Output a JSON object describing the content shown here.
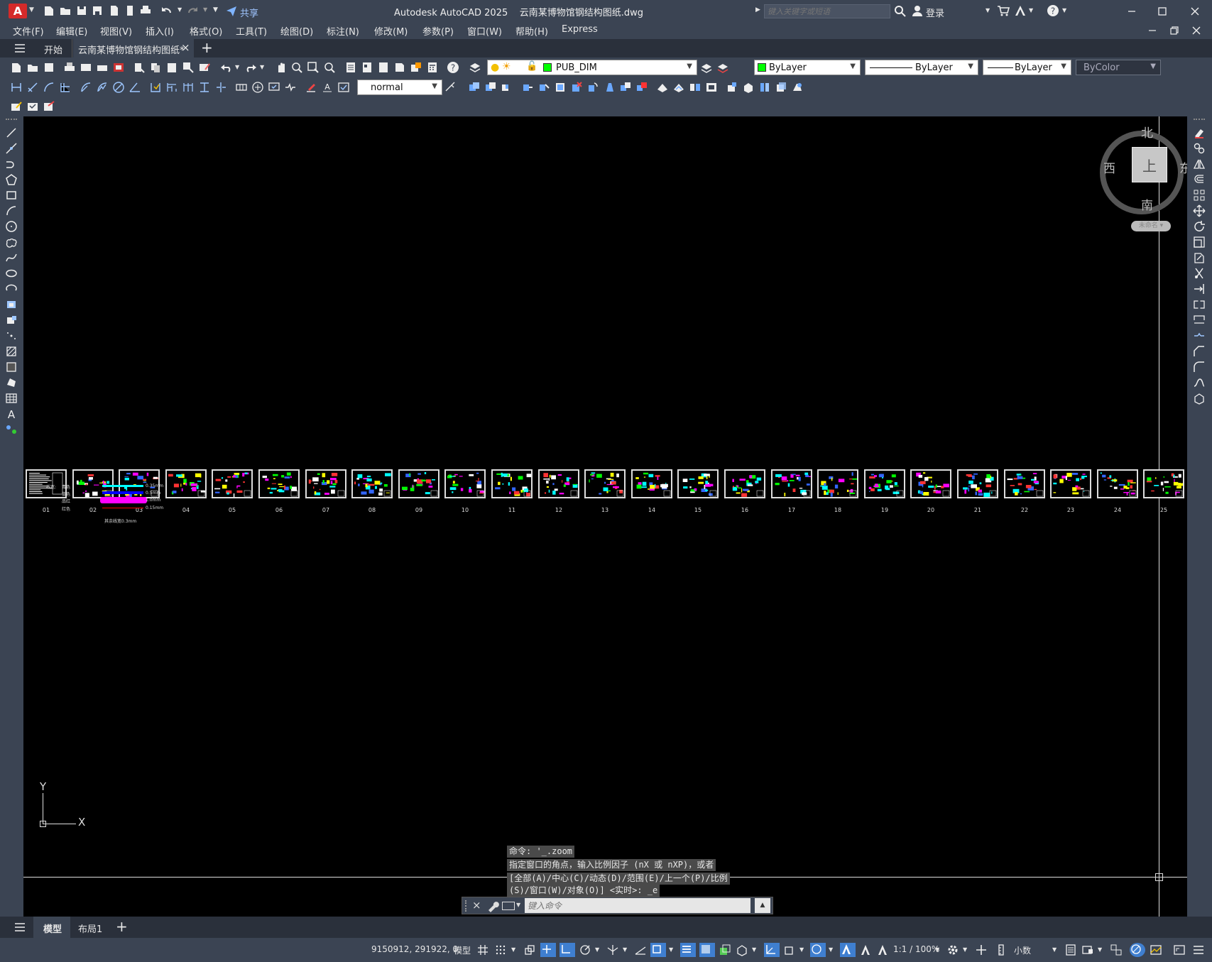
{
  "app": {
    "title": "Autodesk AutoCAD 2025",
    "filename": "云南某博物馆钢结构图纸.dwg",
    "logo_letter": "A",
    "share": "共享",
    "search_placeholder": "键入关键字或短语",
    "login": "登录"
  },
  "menu": [
    "文件(F)",
    "编辑(E)",
    "视图(V)",
    "插入(I)",
    "格式(O)",
    "工具(T)",
    "绘图(D)",
    "标注(N)",
    "修改(M)",
    "参数(P)",
    "窗口(W)",
    "帮助(H)",
    "Express"
  ],
  "tabs": {
    "start": "开始",
    "active": "云南某博物馆钢结构图纸*",
    "close": "×",
    "add": "+"
  },
  "toolbar": {
    "layer": "PUB_DIM",
    "color": "ByLayer",
    "linetype": "ByLayer",
    "lineweight": "ByLayer",
    "plotstyle": "ByColor",
    "textstyle": "normal"
  },
  "viewcube": {
    "north": "北",
    "south": "南",
    "east": "东",
    "west": "西",
    "face": "上",
    "wcs": "未命名"
  },
  "sheets": [
    "01",
    "02",
    "03",
    "04",
    "05",
    "06",
    "07",
    "08",
    "09",
    "10",
    "11",
    "12",
    "13",
    "14",
    "15",
    "16",
    "17",
    "18",
    "19",
    "20",
    "21",
    "22",
    "23",
    "24",
    "25"
  ],
  "legend": {
    "title": "线宽:",
    "rows": [
      {
        "name": "青色",
        "value": "0.35mm",
        "color": "#00ffff"
      },
      {
        "name": "蓝色",
        "value": "0.5mm",
        "color": "#0000ff"
      },
      {
        "name": "品红",
        "value": "1.0mm",
        "color": "#ff00ff"
      },
      {
        "name": "红色",
        "value": "0.15mm",
        "color": "#ff0000"
      }
    ],
    "note": "其余线宽0.3mm"
  },
  "ucs": {
    "x": "X",
    "y": "Y"
  },
  "command": {
    "history": [
      "命令: '_.zoom",
      "指定窗口的角点，输入比例因子 (nX 或 nXP)，或者",
      "[全部(A)/中心(C)/动态(D)/范围(E)/上一个(P)/比例",
      "(S)/窗口(W)/对象(O)] <实时>: _e"
    ],
    "placeholder": "键入命令"
  },
  "layouts": {
    "model": "模型",
    "layout1": "布局1",
    "add": "+"
  },
  "status": {
    "coords": "9150912, 291922, 0",
    "space": "模型",
    "scale": "1:1 / 100%",
    "units": "小数"
  }
}
